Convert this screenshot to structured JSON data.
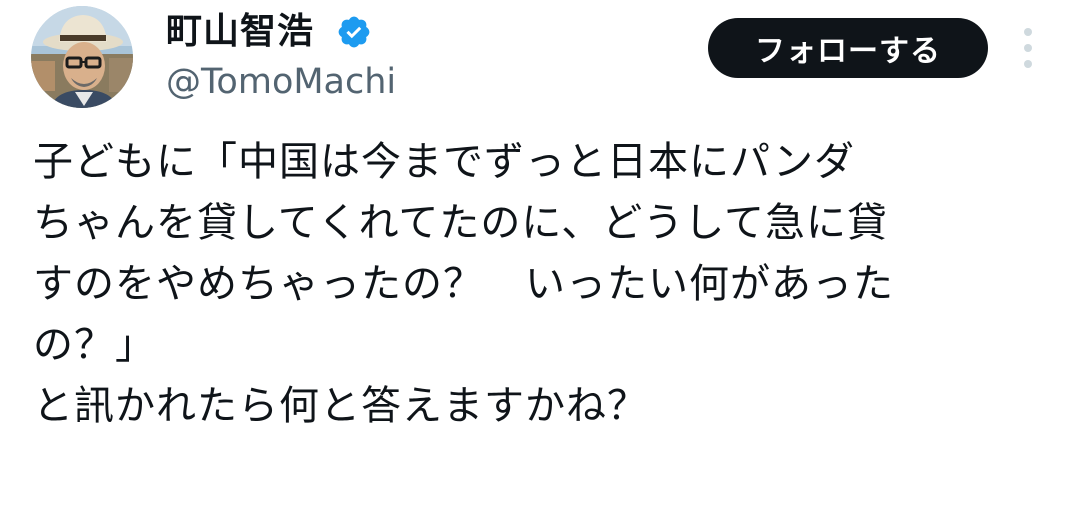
{
  "author": {
    "display_name": "町山智浩",
    "handle": "@TomoMachi",
    "verified": true,
    "avatar_icon": "profile-photo"
  },
  "actions": {
    "follow_label": "フォローする",
    "more_icon": "vertical-ellipsis-icon"
  },
  "tweet": {
    "lines": [
      "子どもに「中国は今までずっと日本にパンダ",
      "ちゃんを貸してくれてたのに、どうして急に貸",
      "すのをやめちゃったの？　いったい何があった",
      "の？」",
      "と訊かれたら何と答えますかね？"
    ]
  },
  "colors": {
    "text_primary": "#0f1419",
    "text_secondary": "#536471",
    "button_bg": "#0f1419",
    "verified_badge": "#1d9bf0",
    "more_dots": "#cfd9de"
  }
}
